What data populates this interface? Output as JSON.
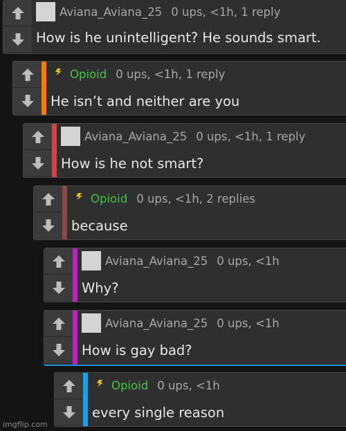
{
  "colors": {
    "orange": "#f07d13",
    "red": "#e83a3a",
    "brown": "#8a4a48",
    "magenta": "#c51cc9",
    "cyan": "#1ea1e2",
    "mod_name": "#46c346"
  },
  "comments": [
    {
      "user": "Aviana_Aviana_25",
      "info": "0 ups, <1h, 1 reply",
      "text": "How is he unintelligent? He sounds smart.",
      "avatar": "blank",
      "stripe": null
    },
    {
      "user": "Opioid",
      "info": "0 ups, <1h, 1 reply",
      "text": "He isn’t and neither are you",
      "avatar": "flag-icon",
      "stripe": "orange"
    },
    {
      "user": "Aviana_Aviana_25",
      "info": "0 ups, <1h, 1 reply",
      "text": "How is he not smart?",
      "avatar": "blank",
      "stripe": "red"
    },
    {
      "user": "Opioid",
      "info": "0 ups, <1h, 2 replies",
      "text": "because",
      "avatar": "flag-icon",
      "stripe": "brown"
    },
    {
      "user": "Aviana_Aviana_25",
      "info": "0 ups, <1h",
      "text": "Why?",
      "avatar": "blank",
      "stripe": "magenta"
    },
    {
      "user": "Aviana_Aviana_25",
      "info": "0 ups, <1h",
      "text": "How is gay bad?",
      "avatar": "blank",
      "stripe": "magenta"
    },
    {
      "user": "Opioid",
      "info": "0 ups, <1h",
      "text": "every single reason",
      "avatar": "flag-icon",
      "stripe": "cyan"
    }
  ],
  "watermark": "imgflip.com"
}
